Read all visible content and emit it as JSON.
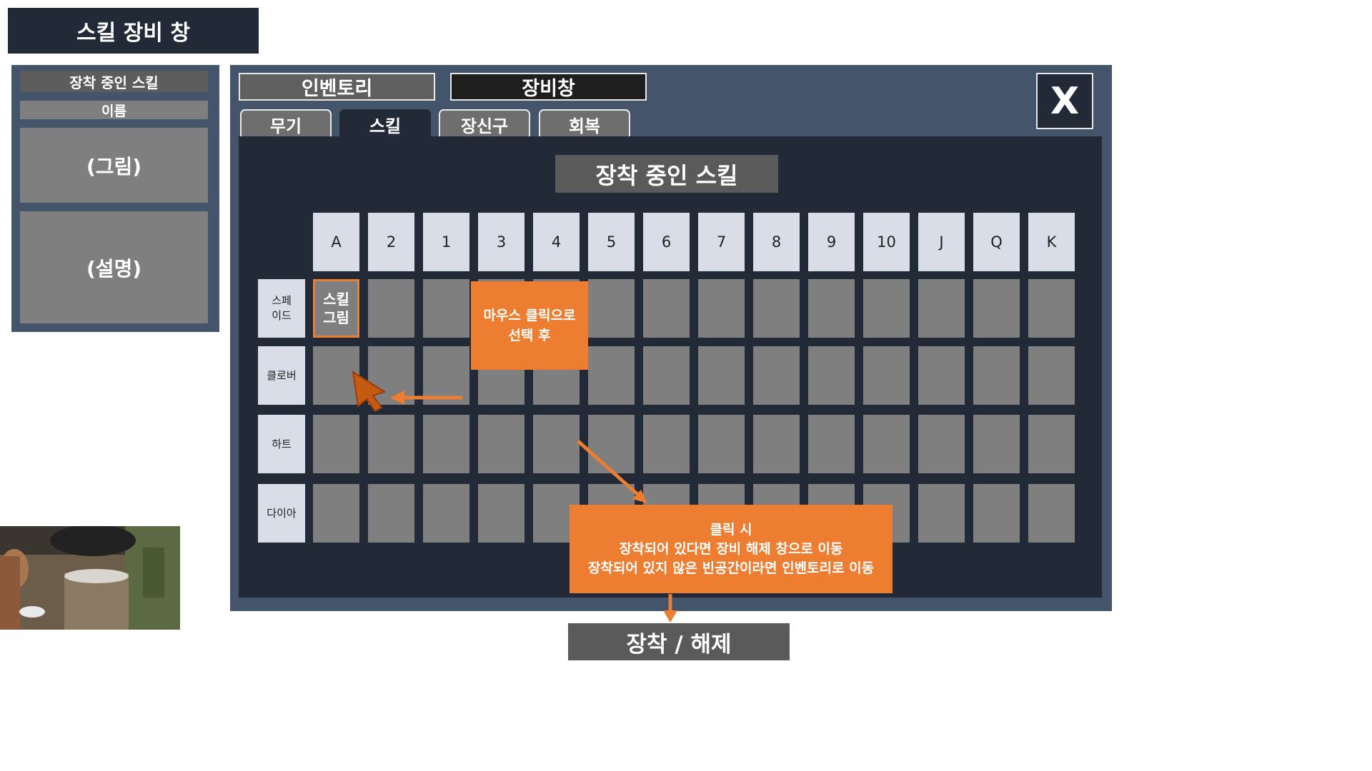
{
  "title": "스킬 장비 창",
  "left_panel": {
    "header": "장착 중인 스킬",
    "name": "이름",
    "picture": "(그림)",
    "description": "(설명)"
  },
  "main": {
    "tabs": {
      "inventory": "인벤토리",
      "equipment": "장비창"
    },
    "close_label": "X",
    "categories": {
      "weapon": "무기",
      "skill": "스킬",
      "accessory": "장신구",
      "recovery": "회복"
    },
    "equipped_title": "장착 중인 스킬",
    "columns": [
      "A",
      "2",
      "1",
      "3",
      "4",
      "5",
      "6",
      "7",
      "8",
      "9",
      "10",
      "J",
      "Q",
      "K"
    ],
    "rows": [
      "스페\n이드",
      "클로버",
      "하트",
      "다이아"
    ],
    "selected_cell_text": "스킬\n그림",
    "callout_select": "마우스 클릭으로\n선택 후",
    "callout_click": "클릭 시\n장착되어 있다면 장비 해제 창으로 이동\n장착되어 있지 않은 빈공간이라면 인벤토리로 이동",
    "equip_button": "장착 / 해제"
  },
  "colors": {
    "dark_navy": "#222a37",
    "slate": "#44546a",
    "slot_gray": "#7f7f7f",
    "header_light": "#d9dde7",
    "accent_orange": "#ed7d31"
  }
}
